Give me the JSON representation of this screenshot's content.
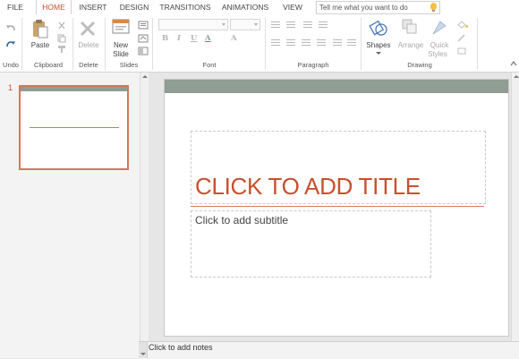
{
  "tabs": [
    {
      "label": "FILE"
    },
    {
      "label": "HOME"
    },
    {
      "label": "INSERT"
    },
    {
      "label": "DESIGN"
    },
    {
      "label": "TRANSITIONS"
    },
    {
      "label": "ANIMATIONS"
    },
    {
      "label": "VIEW"
    }
  ],
  "active_tab": "HOME",
  "tell_me": {
    "placeholder": "Tell me what you want to do"
  },
  "ribbon": {
    "groups": {
      "undo": "Undo",
      "clipboard": "Clipboard",
      "delete": "Delete",
      "slides": "Slides",
      "font": "Font",
      "paragraph": "Paragraph",
      "drawing": "Drawing"
    },
    "buttons": {
      "paste": "Paste",
      "delete": "Delete",
      "new_slide_1": "New",
      "new_slide_2": "Slide",
      "shapes": "Shapes",
      "arrange": "Arrange",
      "quick_styles_1": "Quick",
      "quick_styles_2": "Styles"
    },
    "font_buttons": [
      "B",
      "I",
      "U",
      "A",
      "A"
    ]
  },
  "slide_pane": {
    "slide_number": "1"
  },
  "slide": {
    "title_placeholder": "CLICK TO ADD TITLE",
    "subtitle_placeholder": "Click to add subtitle"
  },
  "notes": {
    "placeholder": "Click to add notes"
  },
  "colors": {
    "accent": "#c8502d",
    "header_band": "#8f9d92",
    "rule": "#d77b5e"
  }
}
